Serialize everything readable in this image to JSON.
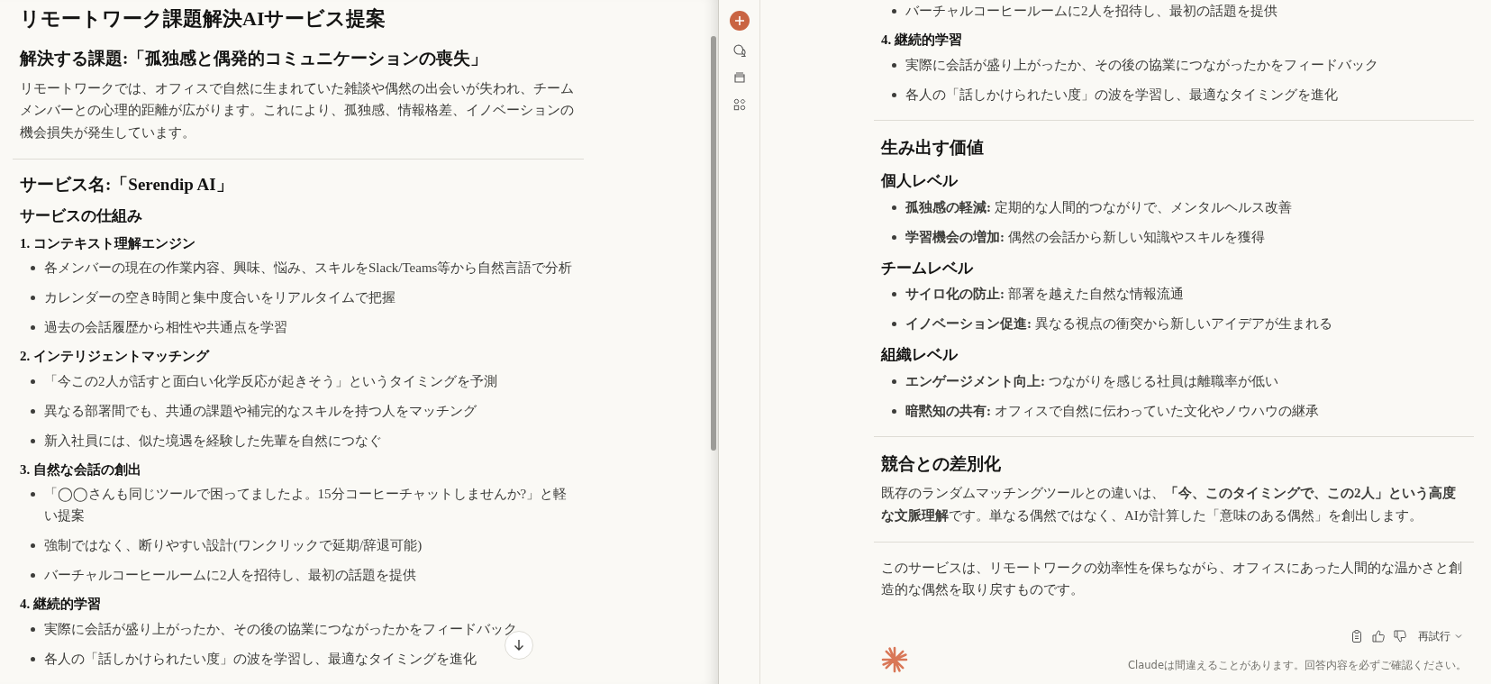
{
  "left_pane": {
    "blocks": [
      {
        "kind": "h1",
        "text": "リモートワーク課題解決AIサービス提案"
      },
      {
        "kind": "h2",
        "text": "解決する課題:「孤独感と偶発的コミュニケーションの喪失」"
      },
      {
        "kind": "p",
        "text": "リモートワークでは、オフィスで自然に生まれていた雑談や偶然の出会いが失われ、チームメンバーとの心理的距離が広がります。これにより、孤独感、情報格差、イノベーションの機会損失が発生しています。"
      },
      {
        "kind": "hr"
      },
      {
        "kind": "h2",
        "text": "サービス名:「Serendip AI」"
      },
      {
        "kind": "h3",
        "text": "サービスの仕組み"
      },
      {
        "kind": "h4",
        "text": "1. コンテキスト理解エンジン"
      },
      {
        "kind": "ul",
        "items": [
          "各メンバーの現在の作業内容、興味、悩み、スキルをSlack/Teams等から自然言語で分析",
          "カレンダーの空き時間と集中度合いをリアルタイムで把握",
          "過去の会話履歴から相性や共通点を学習"
        ]
      },
      {
        "kind": "h4",
        "text": "2. インテリジェントマッチング"
      },
      {
        "kind": "ul",
        "items": [
          "「今この2人が話すと面白い化学反応が起きそう」というタイミングを予測",
          "異なる部署間でも、共通の課題や補完的なスキルを持つ人をマッチング",
          "新入社員には、似た境遇を経験した先輩を自然につなぐ"
        ]
      },
      {
        "kind": "h4",
        "text": "3. 自然な会話の創出"
      },
      {
        "kind": "ul",
        "items": [
          "「◯◯さんも同じツールで困ってましたよ。15分コーヒーチャットしませんか?」と軽い提案",
          "強制ではなく、断りやすい設計(ワンクリックで延期/辞退可能)",
          "バーチャルコーヒールームに2人を招待し、最初の話題を提供"
        ]
      },
      {
        "kind": "h4",
        "text": "4. 継続的学習"
      },
      {
        "kind": "ul",
        "items": [
          "実際に会話が盛り上がったか、その後の協業につながったかをフィードバック",
          "各人の「話しかけられたい度」の波を学習し、最適なタイミングを進化"
        ]
      }
    ]
  },
  "right_pane": {
    "blocks": [
      {
        "kind": "ul",
        "items": [
          "バーチャルコーヒールームに2人を招待し、最初の話題を提供"
        ]
      },
      {
        "kind": "h4",
        "text": "4. 継続的学習"
      },
      {
        "kind": "ul",
        "items": [
          "実際に会話が盛り上がったか、その後の協業につながったかをフィードバック",
          "各人の「話しかけられたい度」の波を学習し、最適なタイミングを進化"
        ]
      },
      {
        "kind": "hr"
      },
      {
        "kind": "h2",
        "text": "生み出す価値"
      },
      {
        "kind": "h3",
        "text": "個人レベル"
      },
      {
        "kind": "ul",
        "items": [
          "**孤独感の軽減:** 定期的な人間的つながりで、メンタルヘルス改善",
          "**学習機会の増加:** 偶然の会話から新しい知識やスキルを獲得"
        ]
      },
      {
        "kind": "h3",
        "text": "チームレベル"
      },
      {
        "kind": "ul",
        "items": [
          "**サイロ化の防止:** 部署を越えた自然な情報流通",
          "**イノベーション促進:** 異なる視点の衝突から新しいアイデアが生まれる"
        ]
      },
      {
        "kind": "h3",
        "text": "組織レベル"
      },
      {
        "kind": "ul",
        "items": [
          "**エンゲージメント向上:** つながりを感じる社員は離職率が低い",
          "**暗黙知の共有:** オフィスで自然に伝わっていた文化やノウハウの継承"
        ]
      },
      {
        "kind": "hr"
      },
      {
        "kind": "h2",
        "text": "競合との差別化"
      },
      {
        "kind": "p",
        "text": "既存のランダムマッチングツールとの違いは、**「今、このタイミングで、この2人」という高度な文脈理解**です。単なる偶然ではなく、AIが計算した「意味のある偶然」を創出します。"
      },
      {
        "kind": "hr"
      },
      {
        "kind": "p",
        "text": "このサービスは、リモートワークの効率性を保ちながら、オフィスにあった人間的な温かさと創造的な偶然を取り戻すものです。"
      }
    ],
    "retry_label": "再試行",
    "disclaimer": "Claudeは間違えることがあります。回答内容を必ずご確認ください。"
  }
}
